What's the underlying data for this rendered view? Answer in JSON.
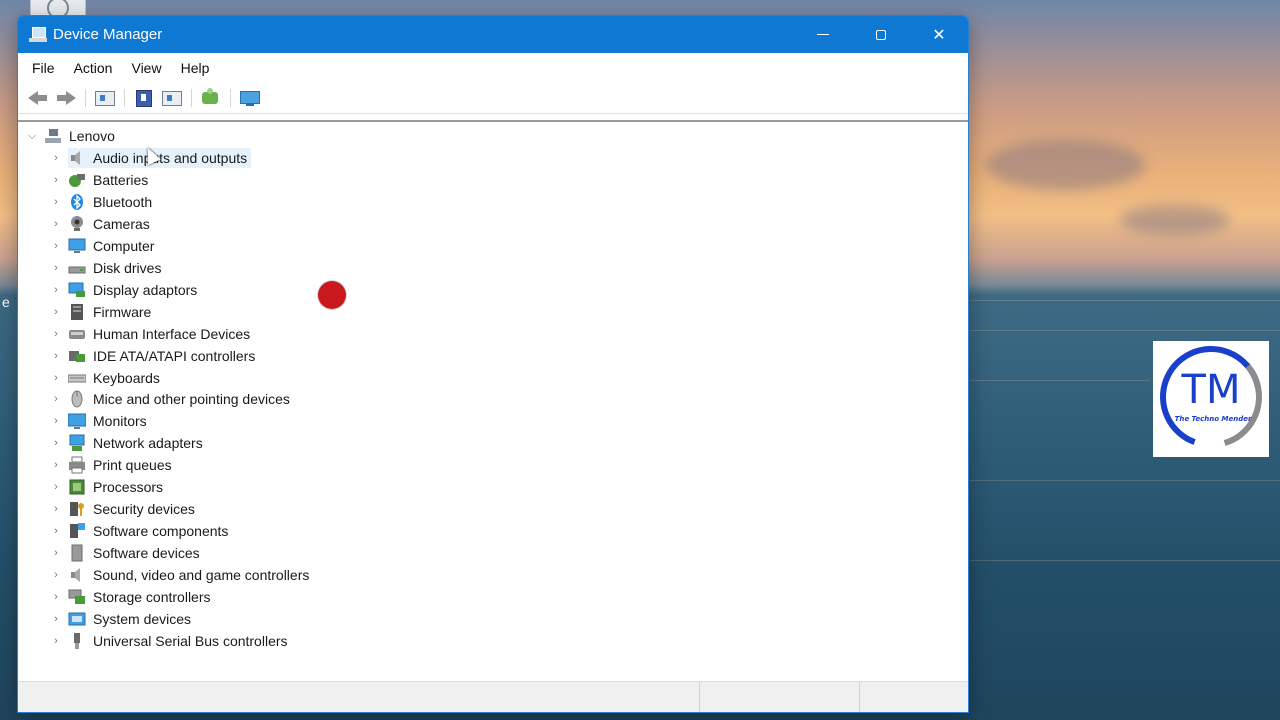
{
  "window": {
    "title": "Device Manager",
    "controls": {
      "minimize": "—",
      "maximize": "",
      "close": "✕"
    }
  },
  "menu": [
    "File",
    "Action",
    "View",
    "Help"
  ],
  "toolbar": {
    "icons": [
      "back-arrow-icon",
      "forward-arrow-icon",
      "show-hide-console-tree-icon",
      "properties-icon",
      "update-driver-icon",
      "scan-hardware-icon",
      "monitor-icon"
    ]
  },
  "tree": {
    "root": {
      "label": "Lenovo",
      "expanded": true,
      "icon": "computer-icon"
    },
    "items": [
      {
        "label": "Audio inputs and outputs",
        "icon": "speaker-icon",
        "selected": true
      },
      {
        "label": "Batteries",
        "icon": "battery-icon"
      },
      {
        "label": "Bluetooth",
        "icon": "bluetooth-icon"
      },
      {
        "label": "Cameras",
        "icon": "camera-icon"
      },
      {
        "label": "Computer",
        "icon": "computer-icon"
      },
      {
        "label": "Disk drives",
        "icon": "disk-drive-icon"
      },
      {
        "label": "Display adaptors",
        "icon": "display-adapter-icon"
      },
      {
        "label": "Firmware",
        "icon": "firmware-icon"
      },
      {
        "label": "Human Interface Devices",
        "icon": "hid-icon"
      },
      {
        "label": "IDE ATA/ATAPI controllers",
        "icon": "ide-controller-icon"
      },
      {
        "label": "Keyboards",
        "icon": "keyboard-icon"
      },
      {
        "label": "Mice and other pointing devices",
        "icon": "mouse-icon"
      },
      {
        "label": "Monitors",
        "icon": "monitor-icon"
      },
      {
        "label": "Network adapters",
        "icon": "network-adapter-icon"
      },
      {
        "label": "Print queues",
        "icon": "printer-icon"
      },
      {
        "label": "Processors",
        "icon": "processor-icon"
      },
      {
        "label": "Security devices",
        "icon": "security-device-icon"
      },
      {
        "label": "Software components",
        "icon": "software-component-icon"
      },
      {
        "label": "Software devices",
        "icon": "software-device-icon"
      },
      {
        "label": "Sound, video and game controllers",
        "icon": "sound-controller-icon"
      },
      {
        "label": "Storage controllers",
        "icon": "storage-controller-icon"
      },
      {
        "label": "System devices",
        "icon": "system-device-icon"
      },
      {
        "label": "Universal Serial Bus controllers",
        "icon": "usb-icon"
      }
    ]
  },
  "desktop": {
    "edge_label": "e"
  },
  "watermark": {
    "letters": "TM",
    "tagline": "The Techno Mender"
  },
  "colors": {
    "titlebar": "#0f78d3",
    "selection": "#e5f1fb",
    "record_dot": "#c9181e",
    "logo_blue": "#1a3fc9",
    "logo_gray": "#8c8c8c"
  }
}
